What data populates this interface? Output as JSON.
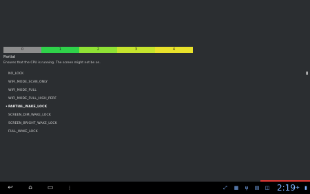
{
  "scale": {
    "segments": [
      {
        "label": "0",
        "color": "#8d8d8d"
      },
      {
        "label": "1",
        "color": "#2fd24a"
      },
      {
        "label": "2",
        "color": "#8fe135"
      },
      {
        "label": "3",
        "color": "#c6e42d"
      },
      {
        "label": "4",
        "color": "#e9e22b"
      }
    ]
  },
  "title": "Partial",
  "description": "Ensures that the CPU is running. The screen might not be on.",
  "lock_options": [
    {
      "label": "NO_LOCK",
      "selected": false
    },
    {
      "label": "WIFI_MODE_SCAN_ONLY",
      "selected": false
    },
    {
      "label": "WIFI_MODE_FULL",
      "selected": false
    },
    {
      "label": "WIFI_MODE_FULL_HIGH_PERF",
      "selected": false
    },
    {
      "label": "PARTIAL_WAKE_LOCK",
      "selected": true
    },
    {
      "label": "SCREEN_DIM_WAKE_LOCK",
      "selected": false
    },
    {
      "label": "SCREEN_BRIGHT_WAKE_LOCK",
      "selected": false
    },
    {
      "label": "FULL_WAKE_LOCK",
      "selected": false
    }
  ],
  "selection_marker": "•",
  "navbar": {
    "back_icon": "back-icon",
    "home_icon": "home-icon",
    "recents_icon": "recent-apps-icon",
    "clock": "2:19"
  }
}
